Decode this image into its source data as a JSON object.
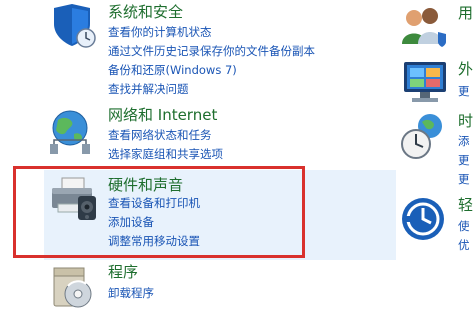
{
  "categories": [
    {
      "title": "系统和安全",
      "links": [
        "查看你的计算机状态",
        "通过文件历史记录保存你的文件备份副本",
        "备份和还原(Windows 7)",
        "查找并解决问题"
      ]
    },
    {
      "title": "网络和 Internet",
      "links": [
        "查看网络状态和任务",
        "选择家庭组和共享选项"
      ]
    },
    {
      "title": "硬件和声音",
      "links": [
        "查看设备和打印机",
        "添加设备",
        "调整常用移动设置"
      ]
    },
    {
      "title": "程序",
      "links": [
        "卸载程序"
      ]
    }
  ],
  "right": {
    "user_title": "用",
    "appearance_title": "外",
    "appearance_link": "更",
    "clock_title": "时",
    "clock_links": [
      "添",
      "更",
      "更"
    ],
    "ease_title": "轻",
    "ease_links": [
      "使",
      "优"
    ]
  },
  "colors": {
    "title_green": "#1e6e2e",
    "link_blue": "#1a55b5",
    "highlight": "#e8f2fc",
    "selection_border": "#d9312d"
  },
  "icons": {
    "system_security": "shield-icon",
    "network": "globe-network-icon",
    "hardware_sound": "printer-speaker-icon",
    "programs": "programs-disk-icon",
    "user_accounts": "users-icon",
    "appearance": "monitor-icon",
    "clock_region": "clock-globe-icon",
    "ease_of_access": "ease-of-access-icon"
  }
}
